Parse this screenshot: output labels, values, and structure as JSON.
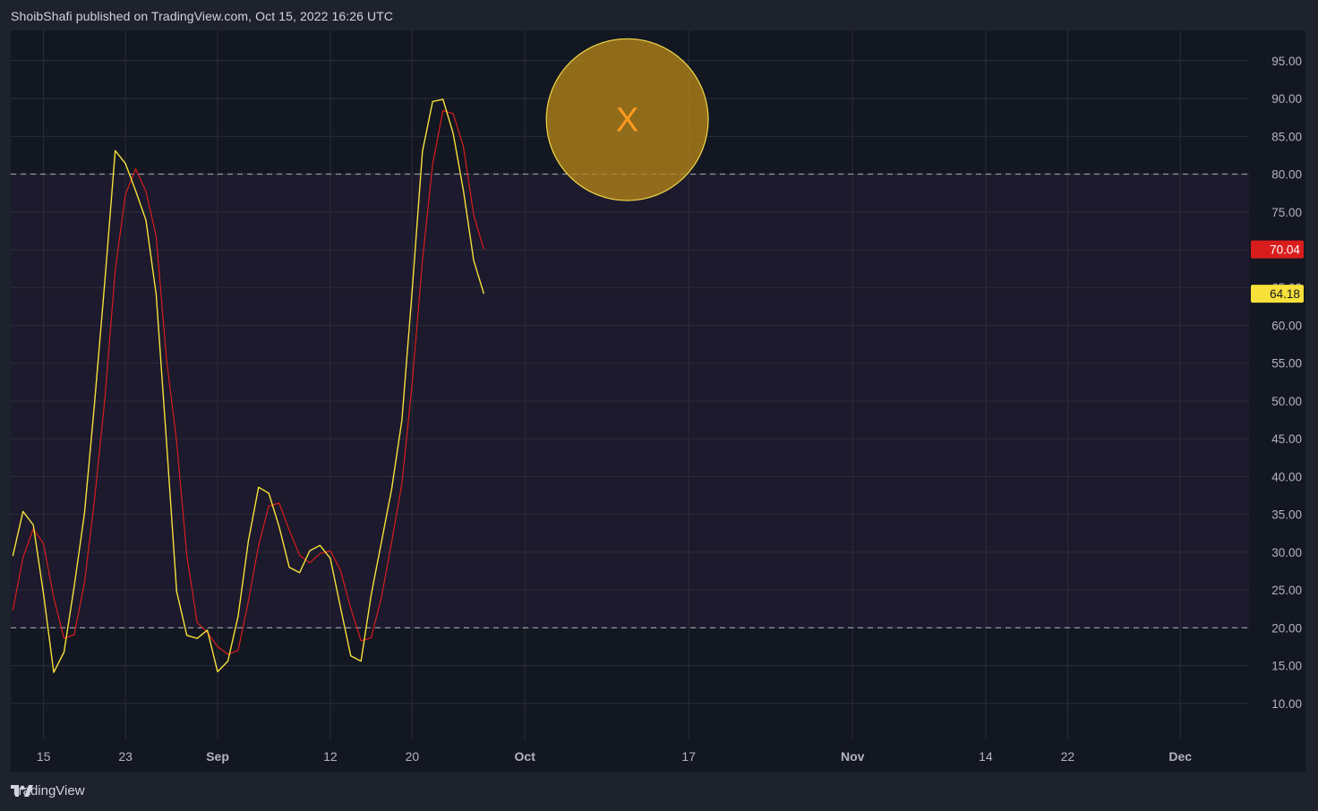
{
  "header": {
    "published_text": "ShoibShafi published on TradingView.com, Oct 15, 2022 16:26 UTC"
  },
  "footer": {
    "brand": "TradingView"
  },
  "colors": {
    "background": "#131722",
    "page": "#1e222d",
    "grid": "#2a2e39",
    "band": "#1c1a2c",
    "fast_line": "#f7e13a",
    "slow_line": "#d91d1d",
    "highlight_fill": "#b38418",
    "highlight_stroke": "#f0d84a",
    "marker": "#ff9a1f"
  },
  "chart_data": {
    "type": "line",
    "title": "",
    "xlabel": "",
    "ylabel": "",
    "ylim": [
      5.25,
      99.0
    ],
    "grid": true,
    "y_ticks": [
      "95.00",
      "90.00",
      "85.00",
      "80.00",
      "75.00",
      "70.00",
      "65.00",
      "60.00",
      "55.00",
      "50.00",
      "45.00",
      "40.00",
      "35.00",
      "30.00",
      "25.00",
      "20.00",
      "15.00",
      "10.00"
    ],
    "x_ticks": [
      "15",
      "23",
      "Sep",
      "12",
      "20",
      "Oct",
      "17",
      "Nov",
      "14",
      "22",
      "Dec"
    ],
    "x_tick_days": [
      -17,
      -9,
      0,
      11,
      19,
      30,
      46,
      62,
      75,
      83,
      94
    ],
    "x_range_days": [
      -20.2,
      100.8
    ],
    "x": [
      -20,
      -19,
      -18,
      -17,
      -16,
      -15,
      -14,
      -13,
      -12,
      -11,
      -10,
      -9,
      -8,
      -7,
      -6,
      -5,
      -4,
      -3,
      -2,
      -1,
      0,
      1,
      2,
      3,
      4,
      5,
      6,
      7,
      8,
      9,
      10,
      11,
      12,
      13,
      14,
      15,
      16,
      17,
      18,
      19,
      20,
      21,
      22,
      23,
      24,
      25,
      26,
      27,
      28,
      29,
      30,
      31,
      32,
      33,
      34,
      35,
      36,
      37,
      38,
      39,
      40,
      41,
      42,
      43,
      44,
      45,
      46
    ],
    "x_label_note": "x values are day offsets from Sep 1, 2022",
    "series": [
      {
        "name": "",
        "color": "#f7e13a",
        "values": [
          29.5,
          35.4,
          33.6,
          24.5,
          14.1,
          16.8,
          25.5,
          35.2,
          50.0,
          66.0,
          83.1,
          81.4,
          77.8,
          73.9,
          64.1,
          44.7,
          24.8,
          19.0,
          18.6,
          19.7,
          14.2,
          15.6,
          21.5,
          31.5,
          38.6,
          37.8,
          33.4,
          28.0,
          27.3,
          30.2,
          30.9,
          29.2,
          22.7,
          16.3,
          15.6,
          24.4,
          31.4,
          38.4,
          47.5,
          64.7,
          83.0,
          89.6,
          89.9,
          85.4,
          77.8,
          68.6,
          64.18
        ]
      },
      {
        "name": "",
        "color": "#d91d1d",
        "values": [
          22.3,
          29.3,
          33.1,
          31.1,
          24.0,
          18.6,
          19.1,
          26.0,
          37.2,
          50.4,
          67.3,
          77.3,
          80.7,
          77.7,
          71.8,
          55.6,
          44.6,
          29.5,
          20.7,
          19.4,
          17.5,
          16.5,
          17.0,
          23.5,
          30.9,
          36.1,
          36.5,
          32.9,
          29.6,
          28.6,
          29.8,
          30.2,
          27.6,
          22.6,
          18.3,
          18.7,
          24.1,
          31.4,
          39.1,
          52.4,
          68.6,
          81.3,
          88.4,
          88.0,
          83.6,
          74.6,
          70.04
        ]
      }
    ],
    "last_value_labels": [
      {
        "series": 0,
        "text": "64.18",
        "value": 64.18
      },
      {
        "series": 1,
        "text": "70.04",
        "value": 70.04
      }
    ],
    "reference_lines": [
      80,
      20
    ],
    "shaded_band": [
      20,
      80
    ],
    "annotation": {
      "text": "X",
      "day": 40,
      "value": 87.2,
      "radius_value": 10.7
    }
  }
}
